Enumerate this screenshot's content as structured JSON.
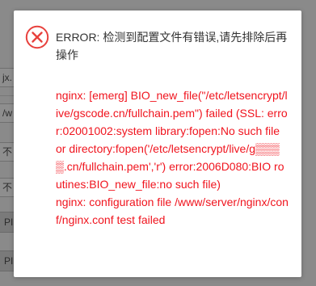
{
  "background": {
    "fields": [
      {
        "text": "jx."
      },
      {
        "text": "/w"
      },
      {
        "text": "不"
      },
      {
        "text": "不"
      }
    ],
    "buttons": [
      {
        "text": "PI"
      },
      {
        "text": "PI"
      }
    ]
  },
  "dialog": {
    "icon": "error-circle-x-icon",
    "title": "ERROR: 检测到配置文件有错误,请先排除后再操作",
    "messages": [
      "nginx: [emerg] BIO_new_file(\"/etc/letsencrypt/live/gscode.cn/fullchain.pem\") failed (SSL: error:02001002:system library:fopen:No such file or directory:fopen('/etc/letsencrypt/live/g▒▒▒▒.cn/fullchain.pem','r') error:2006D080:BIO routines:BIO_new_file:no such file)",
      "nginx: configuration file /www/server/nginx/conf/nginx.conf test failed"
    ]
  },
  "colors": {
    "error_red": "#f0141e",
    "icon_red": "#e8413d",
    "text": "#333333",
    "overlay": "#8a8a8a"
  }
}
